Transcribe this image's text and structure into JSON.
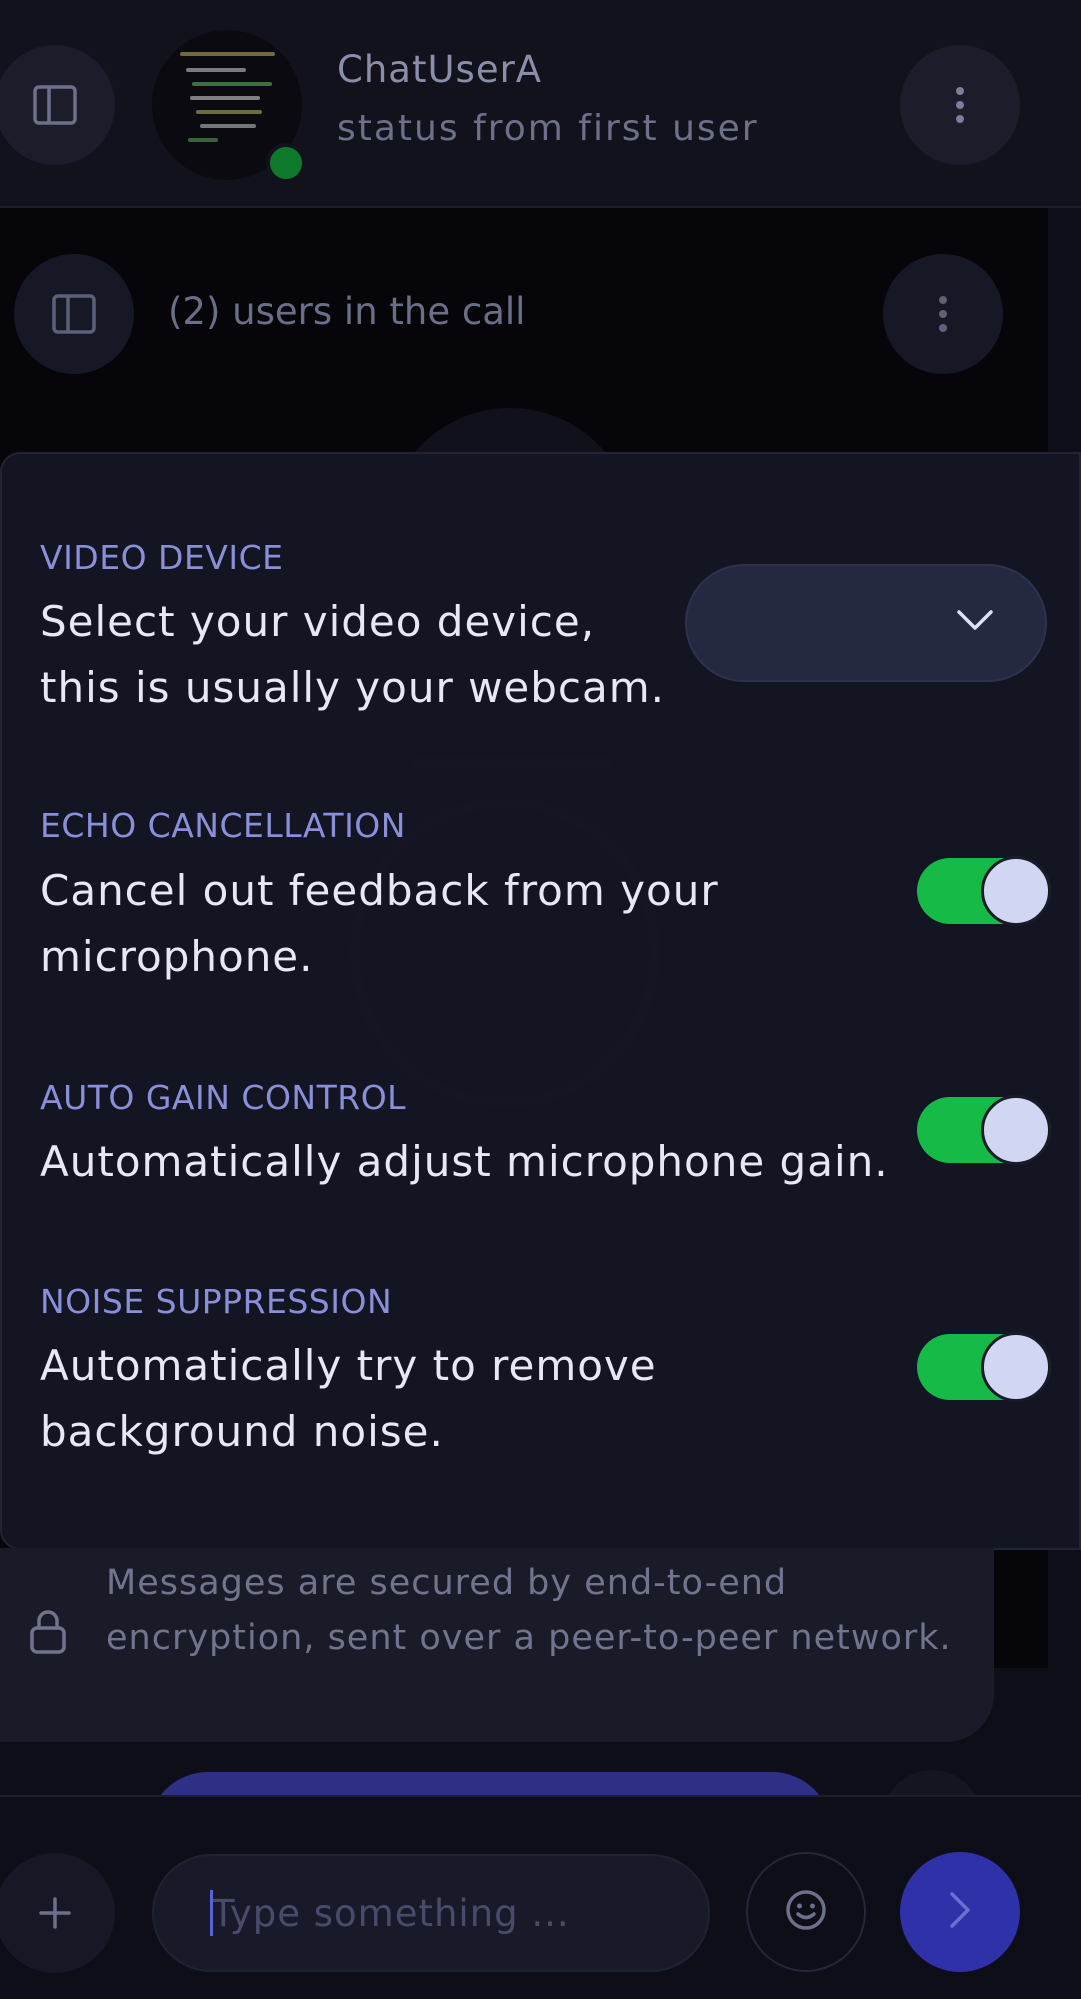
{
  "header": {
    "name": "ChatUserA",
    "status": "status from first user",
    "online": true
  },
  "call": {
    "users_label": "(2) users in the call"
  },
  "settings": {
    "video_device": {
      "title": "VIDEO DEVICE",
      "description_line1": "Select your video device,",
      "description_line2": "this is usually your webcam.",
      "selected": ""
    },
    "echo_cancellation": {
      "title": "ECHO CANCELLATION",
      "description_line1": "Cancel out feedback from your",
      "description_line2": "microphone.",
      "enabled": true
    },
    "auto_gain_control": {
      "title": "AUTO GAIN CONTROL",
      "description_line1": "Automatically adjust microphone gain.",
      "enabled": true
    },
    "noise_suppression": {
      "title": "NOISE SUPPRESSION",
      "description_line1": "Automatically try to remove",
      "description_line2": "background noise.",
      "enabled": true
    }
  },
  "notice": {
    "text": "Messages are secured by end-to-end encryption, sent over a peer-to-peer network."
  },
  "composer": {
    "placeholder": "Type something ..."
  },
  "colors": {
    "accent": "#2f31a8",
    "toggle_on": "#17c149",
    "setting_title": "#8e94e0"
  }
}
